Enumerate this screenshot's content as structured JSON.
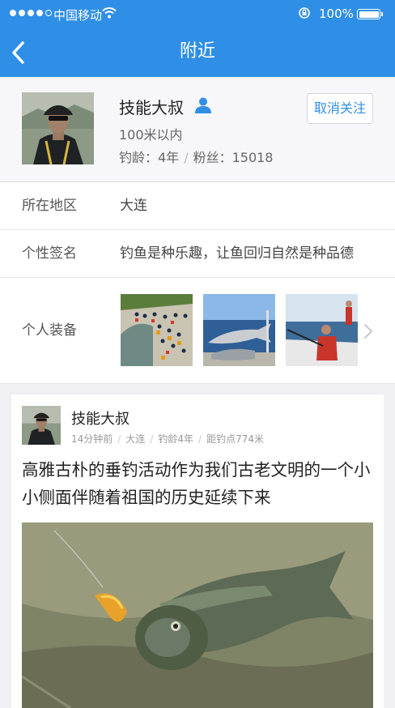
{
  "status_bar": {
    "carrier": "中国移动",
    "battery": "100%",
    "signal_bars_filled": 4,
    "signal_bars_total": 5
  },
  "nav": {
    "title": "附近",
    "back_icon": "chevron-left-icon"
  },
  "profile": {
    "name": "技能大叔",
    "distance": "100米以内",
    "fishing_age": "钓龄：4年",
    "fans": "粉丝：15018",
    "unfollow_label": "取消关注"
  },
  "info_rows": {
    "region_label": "所在地区",
    "region_value": "大连",
    "signature_label": "个性签名",
    "signature_value": "钓鱼是种乐趣，让鱼回归自然是种品德",
    "equipment_label": "个人装备"
  },
  "post": {
    "author": "技能大叔",
    "time": "14分钟前",
    "location": "大连",
    "fishing_age": "钓龄4年",
    "distance": "距钓点774米",
    "text": "高雅古朴的垂钓活动作为我们古老文明的一个小小侧面伴随着祖国的历史延续下来"
  },
  "colors": {
    "accent": "#2f8fe6",
    "background": "#efeff4"
  }
}
